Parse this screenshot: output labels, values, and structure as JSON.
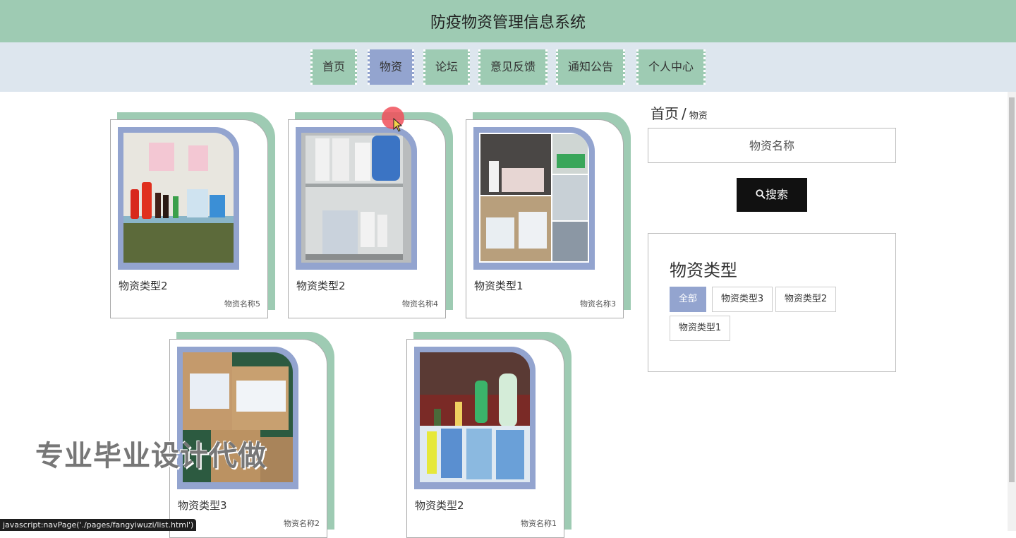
{
  "header": {
    "title": "防疫物资管理信息系统"
  },
  "nav": {
    "items": [
      {
        "label": "首页",
        "active": false
      },
      {
        "label": "物资",
        "active": true
      },
      {
        "label": "论坛",
        "active": false
      },
      {
        "label": "意见反馈",
        "active": false
      },
      {
        "label": "通知公告",
        "active": false
      },
      {
        "label": "个人中心",
        "active": false
      }
    ]
  },
  "products": [
    {
      "type": "物资类型2",
      "name": "物资名称5"
    },
    {
      "type": "物资类型2",
      "name": "物资名称4"
    },
    {
      "type": "物资类型1",
      "name": "物资名称3"
    },
    {
      "type": "物资类型3",
      "name": "物资名称2"
    },
    {
      "type": "物资类型2",
      "name": "物资名称1"
    }
  ],
  "breadcrumb": {
    "home": "首页",
    "separator": "/",
    "current": "物资"
  },
  "search": {
    "placeholder": "物资名称",
    "button_label": "搜索",
    "button_icon": "search-icon"
  },
  "filter": {
    "title": "物资类型",
    "options": [
      {
        "label": "全部",
        "active": true
      },
      {
        "label": "物资类型3",
        "active": false
      },
      {
        "label": "物资类型2",
        "active": false
      },
      {
        "label": "物资类型1",
        "active": false
      }
    ]
  },
  "watermark": "专业毕业设计代做",
  "status_bar": "javascript:navPage('./pages/fangyiwuzi/list.html')",
  "colors": {
    "header": "#9ecbb3",
    "nav_bg": "#dde6ee",
    "accent": "#93a4cf",
    "button": "#111111"
  }
}
